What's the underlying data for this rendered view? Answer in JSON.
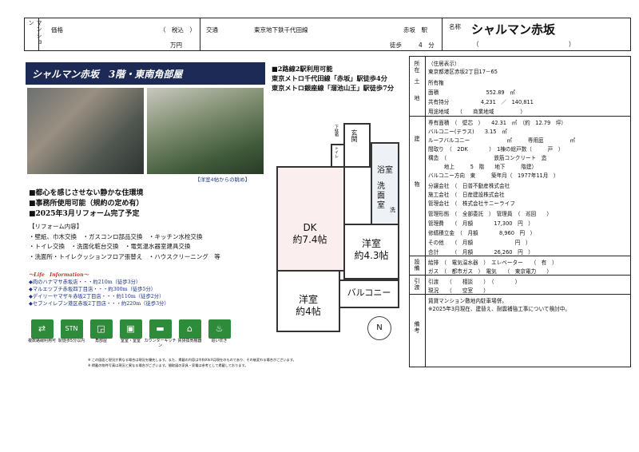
{
  "header": {
    "mansion_label": "マンション",
    "price_label": "価格",
    "tax_note": "（　税込　）",
    "price_unit": "万円",
    "transport_label": "交通",
    "line_name": "東京地下鉄千代田線",
    "station": "赤坂　駅",
    "walk_label": "徒歩",
    "walk_value": "4　分",
    "name_label": "名称",
    "name": "シャルマン赤坂",
    "name_paren": "（　　　　　　　　　　　　　　　）"
  },
  "banner": "シャルマン赤坂　3階・東南角部屋",
  "photo_caption": "【洋室4帖からの眺め】",
  "access": {
    "title": "■2路線2駅利用可能",
    "line1": "東京メトロ千代田線「赤坂」駅徒歩4分",
    "line2": "東京メトロ銀座線「溜池山王」駅徒歩7分"
  },
  "features": [
    "■都心を感じさせない静かな住環境",
    "■事務所使用可能（規約の定め有）",
    "■2025年3月リフォーム完了予定"
  ],
  "renovation": {
    "title": "【リフォーム内容】",
    "lines": [
      "・壁紙、巾木交換　・ガスコンロ部品交換　・キッチン水栓交換",
      "・トイレ交換　・洗面化粧台交換　・電気温水器室建具交換",
      "・洗面所・トイレクッションフロア張替え　・ハウスクリーニング　等"
    ]
  },
  "life": {
    "title": "～Life　Information～",
    "items": [
      "◆肉のハナマサ赤坂店・・・約210m（徒歩3分）",
      "◆マルエツプチ赤坂四丁目店・・・約300m（徒歩5分）",
      "◆デイリーヤマザキ赤坂2丁目店・・・約110m（徒歩2分）",
      "◆セブンイレブン港区赤坂2丁目店・・・約220m（徒歩3分）"
    ]
  },
  "icons": [
    {
      "icon": "two-lines-icon",
      "glyph": "⇄",
      "label": "複数路線利用可"
    },
    {
      "icon": "station-icon",
      "glyph": "STN",
      "label": "駅徒歩5分以内"
    },
    {
      "icon": "corner-room-icon",
      "glyph": "◲",
      "label": "角部屋"
    },
    {
      "icon": "office-use-icon",
      "glyph": "▣",
      "label": "室室・室室"
    },
    {
      "icon": "counter-kitchen-icon",
      "glyph": "▬",
      "label": "カウンターキッチン"
    },
    {
      "icon": "lease-icon",
      "glyph": "⌂",
      "label": "賃貸換気機器"
    },
    {
      "icon": "bath-icon",
      "glyph": "♨",
      "label": "追い炊き"
    }
  ],
  "footnote1": "※ この図面と現況が異なる場合は現況を優先します。また、掲載の内容は令和X年X月現在のものであり、その後変わる場合がございます。",
  "footnote2": "※ 掲載の物件写真は現況と異なる場合がございます。間取図の家具・家電は参考として掲載しております。",
  "floorplan": {
    "genkan": "玄関",
    "toilet": "トイレ",
    "storage": "下駄箱",
    "bath": "浴室",
    "wash": "洗面室",
    "wm": "洗",
    "dk": "DK\n約7.4帖",
    "room1": "洋室\n約4.3帖",
    "room2": "洋室\n約4帖",
    "balcony": "バルコニー",
    "north": "N"
  },
  "side_labels": {
    "location": "所在",
    "land": "土地",
    "building": "建物",
    "facility": "設備",
    "hikiwatashi": "引渡",
    "notes": "備考"
  },
  "details": {
    "address_label": "（住居表示）",
    "address": "東京都港区赤坂2丁目17－65",
    "ownership": "所有権",
    "area": "面積　　　　　　　　　552.89　㎡",
    "share": "共有持分　　　　　　4,231　／　140,811",
    "zoning": "用途地域　　（　　商業地域　　　　　）",
    "floor_area": "専有面積　（　壁芯　）　　42.31　㎡　（約　12.79　坪）",
    "balcony": "バルコニー(テラス)　　3.15　㎡",
    "roof": "ルーフバルコニー　　　　　　　㎡　　　専用庭　　　　　㎡",
    "layout": "間取り　（　2DK　　　　）　1棟の総戸数（　　　戸　）",
    "structure": "構造　（　　　　　　　　　鉄筋コンクリート　造",
    "floors": "　　　地上　　　5　階　　地下　　　階建）",
    "direction": "バルコニー方向　東　　　築年月（　1977年11月　）",
    "seller": "分譲会社　（　日普不動産株式会社",
    "builder": "施工会社　（　日産建設株式会社",
    "manager": "管理会社　（　株式会社サニーライフ",
    "manage_type": "管理形態　（　全部委託　）　管理員　（　巡回　　）",
    "fee": "管理費　　（　月額　　　　17,300　円　）",
    "repair": "修繕積立金　（　月額　　　　8,960　円　）",
    "other": "その他　　（　月額　　　　　　　　円　）",
    "total": "合計　　　（　月額　　　　26,260　円　）",
    "water": "給排　（　電気温水器　）　エレベーター　　（　有　）",
    "gas": "ガス　（　都市ガス　）　電気　　（　東京電力　　）",
    "delivery": "引渡　　（　　相談　　）　（　　　　）",
    "status": "現況　　（　　空室　　）",
    "note1": "賃貸マンション敷地内駐車場併。",
    "note2": "※2025年3月現在、建替え、耐震補強工事について検討中。"
  }
}
